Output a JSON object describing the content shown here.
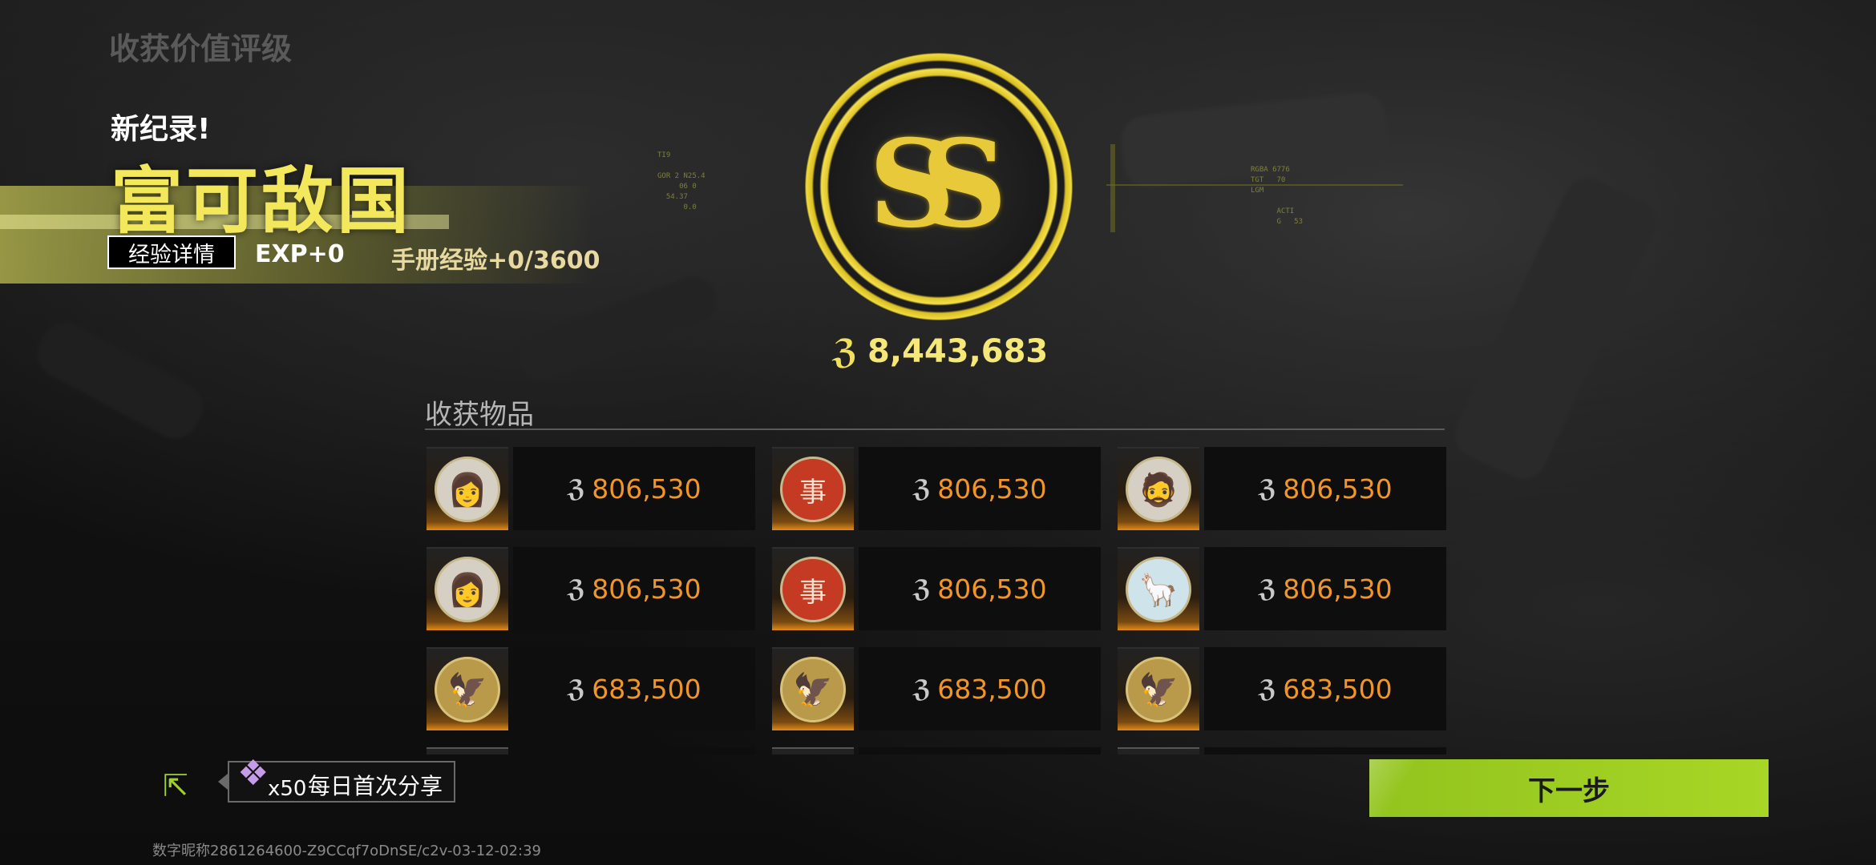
{
  "header": {
    "section_title": "收获价值评级",
    "new_record": "新纪录!",
    "grade_title": "富可敌国",
    "exp_detail_button": "经验详情",
    "exp_gain": "EXP+0",
    "manual_exp": "手册经验+0/3600"
  },
  "medal": {
    "grade": "SS",
    "currency_icon": "koen-coin-icon",
    "total_value": "8,443,683"
  },
  "items": {
    "label": "收获物品",
    "list": [
      {
        "icon": "portrait-girl-icon",
        "glyph": "👩",
        "value": "806,530"
      },
      {
        "icon": "red-seal-icon",
        "glyph": "事",
        "value": "806,530"
      },
      {
        "icon": "portrait-man-icon",
        "glyph": "🧔",
        "value": "806,530"
      },
      {
        "icon": "portrait-girl-bag-icon",
        "glyph": "👩",
        "value": "806,530"
      },
      {
        "icon": "red-seal-icon",
        "glyph": "事",
        "value": "806,530"
      },
      {
        "icon": "alpaca-icon",
        "glyph": "🦙",
        "value": "806,530"
      },
      {
        "icon": "gold-eagle-coin-icon",
        "glyph": "🦅",
        "value": "683,500"
      },
      {
        "icon": "gold-eagle-coin-icon",
        "glyph": "🦅",
        "value": "683,500"
      },
      {
        "icon": "gold-eagle-coin-icon",
        "glyph": "🦅",
        "value": "683,500"
      }
    ]
  },
  "share": {
    "reward_count": "x50",
    "label": "每日首次分享"
  },
  "next_button": "下一步",
  "footer": "数字昵称2861264600-Z9CCqf7oDnSE/c2v-03-12-02:39",
  "colors": {
    "accent_yellow": "#f3e75c",
    "price_orange": "#f0952a",
    "next_green": "#9ccd22"
  }
}
